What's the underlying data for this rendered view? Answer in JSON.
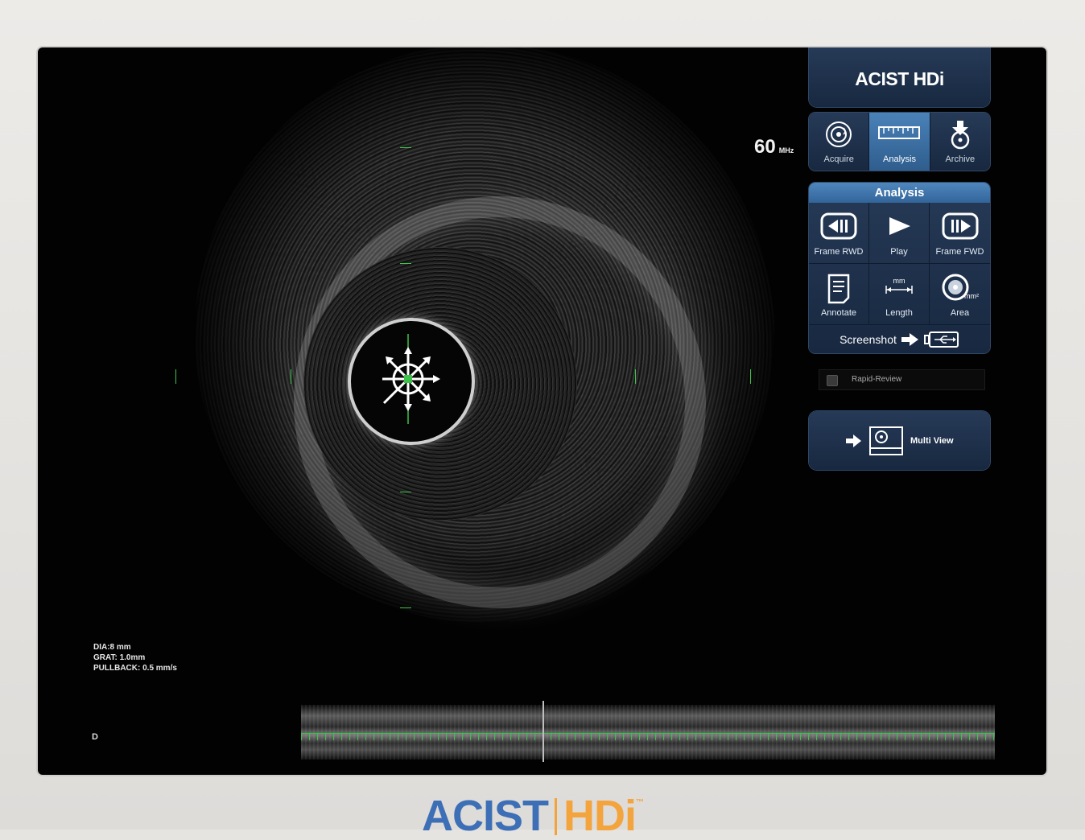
{
  "device": {
    "brand": "ACIST",
    "model": "HDi",
    "trademark": "™"
  },
  "header": {
    "logo_text": "ACIST HDi"
  },
  "frequency": {
    "value": "60",
    "unit": "MHz"
  },
  "tabs": [
    {
      "label": "Acquire",
      "icon": "acquire-icon",
      "active": false
    },
    {
      "label": "Analysis",
      "icon": "ruler-icon",
      "active": true
    },
    {
      "label": "Archive",
      "icon": "archive-icon",
      "active": false
    }
  ],
  "analysis": {
    "title": "Analysis",
    "buttons": [
      {
        "label": "Frame RWD",
        "icon": "frame-rewind-icon"
      },
      {
        "label": "Play",
        "icon": "play-icon"
      },
      {
        "label": "Frame FWD",
        "icon": "frame-forward-icon"
      },
      {
        "label": "Annotate",
        "icon": "annotate-icon"
      },
      {
        "label": "Length",
        "icon": "length-icon",
        "unit": "mm"
      },
      {
        "label": "Area",
        "icon": "area-icon",
        "unit": "mm²"
      }
    ],
    "screenshot_label": "Screenshot"
  },
  "rapid_review": {
    "label": "Rapid-Review",
    "checked": false
  },
  "multi_view": {
    "label": "Multi View"
  },
  "image_info": {
    "dia": "DIA:8 mm",
    "grat": "GRAT: 1.0mm",
    "pullback": "PULLBACK: 0.5 mm/s",
    "marker": "D"
  },
  "colors": {
    "panel": "#1d3049",
    "panel_active": "#3b70a6",
    "marker_green": "#3ec34a",
    "brand_blue": "#3d6fb6",
    "brand_orange": "#f3a43d"
  }
}
